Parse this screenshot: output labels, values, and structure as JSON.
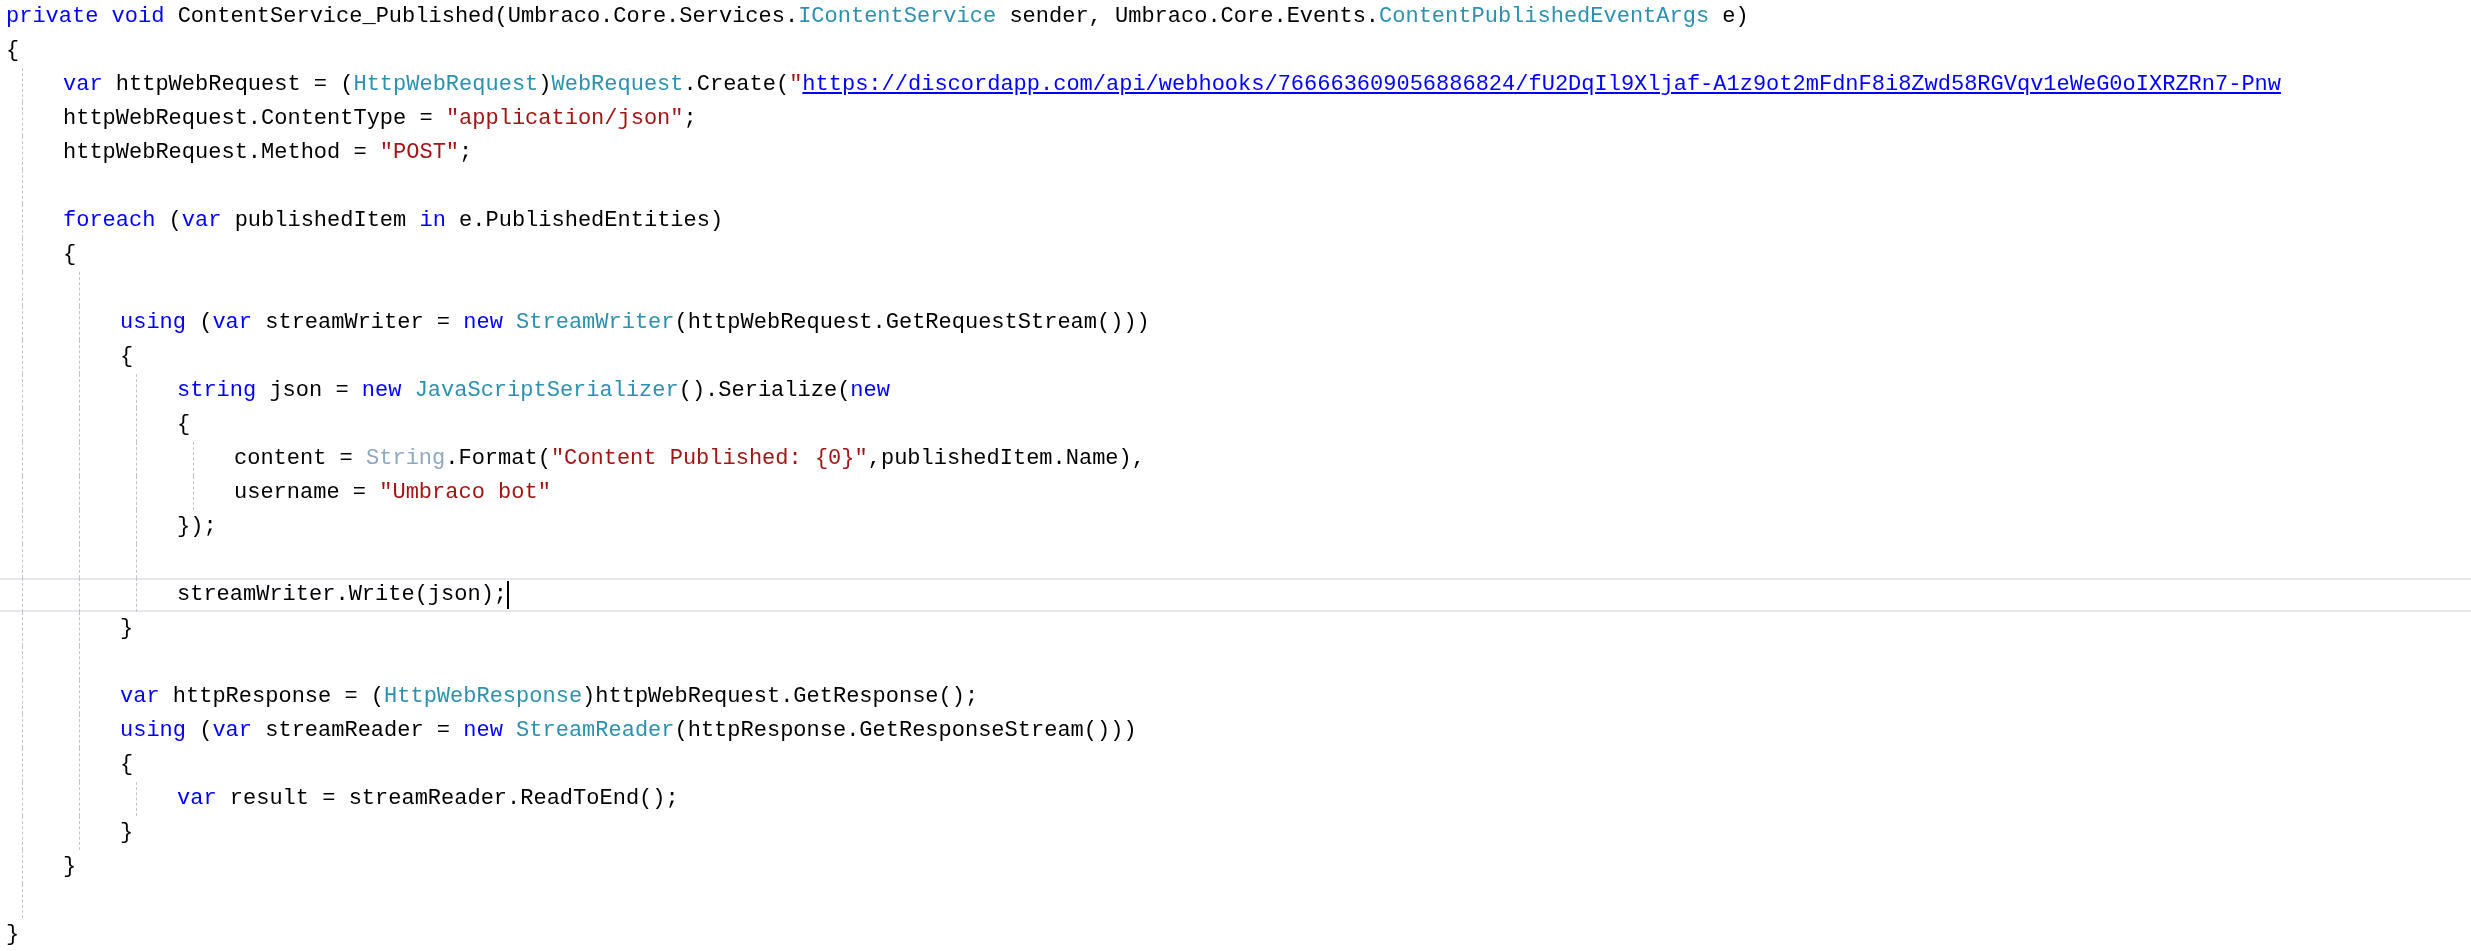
{
  "editor": {
    "lines": [
      {
        "kind": "code",
        "current": false,
        "tokens": [
          {
            "kind": "keyword",
            "text": "private void"
          },
          {
            "kind": "plain",
            "text": " ContentService_Published(Umbraco.Core.Services."
          },
          {
            "kind": "type",
            "text": "IContentService"
          },
          {
            "kind": "plain",
            "text": " sender, Umbraco.Core.Events."
          },
          {
            "kind": "type",
            "text": "ContentPublishedEventArgs"
          },
          {
            "kind": "plain",
            "text": " e)"
          }
        ]
      },
      {
        "kind": "code",
        "current": false,
        "tokens": [
          {
            "kind": "plain",
            "text": "{"
          }
        ]
      },
      {
        "kind": "code",
        "current": false,
        "tokens": [
          {
            "kind": "keyword",
            "text": "    var"
          },
          {
            "kind": "plain",
            "text": " httpWebRequest = ("
          },
          {
            "kind": "type",
            "text": "HttpWebRequest"
          },
          {
            "kind": "plain",
            "text": ")"
          },
          {
            "kind": "type",
            "text": "WebRequest"
          },
          {
            "kind": "plain",
            "text": ".Create("
          },
          {
            "kind": "string",
            "text": "\""
          },
          {
            "kind": "link",
            "text": "https://discordapp.com/api/webhooks/766663609056886824/fU2DqIl9Xljaf-A1z9ot2mFdnF8i8Zwd58RGVqv1eWeG0oIXRZRn7-Pnw"
          }
        ]
      },
      {
        "kind": "code",
        "current": false,
        "tokens": [
          {
            "kind": "plain",
            "text": "    httpWebRequest.ContentType = "
          },
          {
            "kind": "string",
            "text": "\"application/json\""
          },
          {
            "kind": "plain",
            "text": ";"
          }
        ]
      },
      {
        "kind": "code",
        "current": false,
        "tokens": [
          {
            "kind": "plain",
            "text": "    httpWebRequest.Method = "
          },
          {
            "kind": "string",
            "text": "\"POST\""
          },
          {
            "kind": "plain",
            "text": ";"
          }
        ]
      },
      {
        "kind": "blank",
        "current": false
      },
      {
        "kind": "code",
        "current": false,
        "tokens": [
          {
            "kind": "keyword",
            "text": "    foreach"
          },
          {
            "kind": "plain",
            "text": " ("
          },
          {
            "kind": "keyword",
            "text": "var"
          },
          {
            "kind": "plain",
            "text": " publishedItem "
          },
          {
            "kind": "keyword",
            "text": "in"
          },
          {
            "kind": "plain",
            "text": " e.PublishedEntities)"
          }
        ]
      },
      {
        "kind": "code",
        "current": false,
        "tokens": [
          {
            "kind": "plain",
            "text": "    {"
          }
        ]
      },
      {
        "kind": "blank",
        "current": false
      },
      {
        "kind": "code",
        "current": false,
        "tokens": [
          {
            "kind": "keyword",
            "text": "        using"
          },
          {
            "kind": "plain",
            "text": " ("
          },
          {
            "kind": "keyword",
            "text": "var"
          },
          {
            "kind": "plain",
            "text": " streamWriter = "
          },
          {
            "kind": "keyword",
            "text": "new"
          },
          {
            "kind": "type",
            "text": " StreamWriter"
          },
          {
            "kind": "plain",
            "text": "(httpWebRequest.GetRequestStream()))"
          }
        ]
      },
      {
        "kind": "code",
        "current": false,
        "tokens": [
          {
            "kind": "plain",
            "text": "        {"
          }
        ]
      },
      {
        "kind": "code",
        "current": false,
        "tokens": [
          {
            "kind": "keyword",
            "text": "            string"
          },
          {
            "kind": "plain",
            "text": " json = "
          },
          {
            "kind": "keyword",
            "text": "new"
          },
          {
            "kind": "type",
            "text": " JavaScriptSerializer"
          },
          {
            "kind": "plain",
            "text": "().Serialize("
          },
          {
            "kind": "keyword",
            "text": "new"
          }
        ]
      },
      {
        "kind": "code",
        "current": false,
        "tokens": [
          {
            "kind": "plain",
            "text": "            {"
          }
        ]
      },
      {
        "kind": "code",
        "current": false,
        "tokens": [
          {
            "kind": "plain",
            "text": "                content = "
          },
          {
            "kind": "faded",
            "text": "String"
          },
          {
            "kind": "plain",
            "text": ".Format("
          },
          {
            "kind": "string",
            "text": "\"Content Published: {0}\""
          },
          {
            "kind": "plain",
            "text": ",publishedItem.Name),"
          }
        ]
      },
      {
        "kind": "code",
        "current": false,
        "tokens": [
          {
            "kind": "plain",
            "text": "                username = "
          },
          {
            "kind": "string",
            "text": "\"Umbraco bot\""
          }
        ]
      },
      {
        "kind": "code",
        "current": false,
        "tokens": [
          {
            "kind": "plain",
            "text": "            });"
          }
        ]
      },
      {
        "kind": "blank",
        "current": false
      },
      {
        "kind": "code",
        "current": true,
        "tokens": [
          {
            "kind": "plain",
            "text": "            streamWriter.Write(json);"
          }
        ]
      },
      {
        "kind": "code",
        "current": false,
        "tokens": [
          {
            "kind": "plain",
            "text": "        }"
          }
        ]
      },
      {
        "kind": "blank",
        "current": false
      },
      {
        "kind": "code",
        "current": false,
        "tokens": [
          {
            "kind": "keyword",
            "text": "        var"
          },
          {
            "kind": "plain",
            "text": " httpResponse = ("
          },
          {
            "kind": "type",
            "text": "HttpWebResponse"
          },
          {
            "kind": "plain",
            "text": ")httpWebRequest.GetResponse();"
          }
        ]
      },
      {
        "kind": "code",
        "current": false,
        "tokens": [
          {
            "kind": "keyword",
            "text": "        using"
          },
          {
            "kind": "plain",
            "text": " ("
          },
          {
            "kind": "keyword",
            "text": "var"
          },
          {
            "kind": "plain",
            "text": " streamReader = "
          },
          {
            "kind": "keyword",
            "text": "new"
          },
          {
            "kind": "type",
            "text": " StreamReader"
          },
          {
            "kind": "plain",
            "text": "(httpResponse.GetResponseStream()))"
          }
        ]
      },
      {
        "kind": "code",
        "current": false,
        "tokens": [
          {
            "kind": "plain",
            "text": "        {"
          }
        ]
      },
      {
        "kind": "code",
        "current": false,
        "tokens": [
          {
            "kind": "keyword",
            "text": "            var"
          },
          {
            "kind": "plain",
            "text": " result = streamReader.ReadToEnd();"
          }
        ]
      },
      {
        "kind": "code",
        "current": false,
        "tokens": [
          {
            "kind": "plain",
            "text": "        }"
          }
        ]
      },
      {
        "kind": "code",
        "current": false,
        "tokens": [
          {
            "kind": "plain",
            "text": "    }"
          }
        ]
      },
      {
        "kind": "blank",
        "current": false
      },
      {
        "kind": "code",
        "current": false,
        "tokens": [
          {
            "kind": "plain",
            "text": "}"
          }
        ]
      }
    ]
  }
}
